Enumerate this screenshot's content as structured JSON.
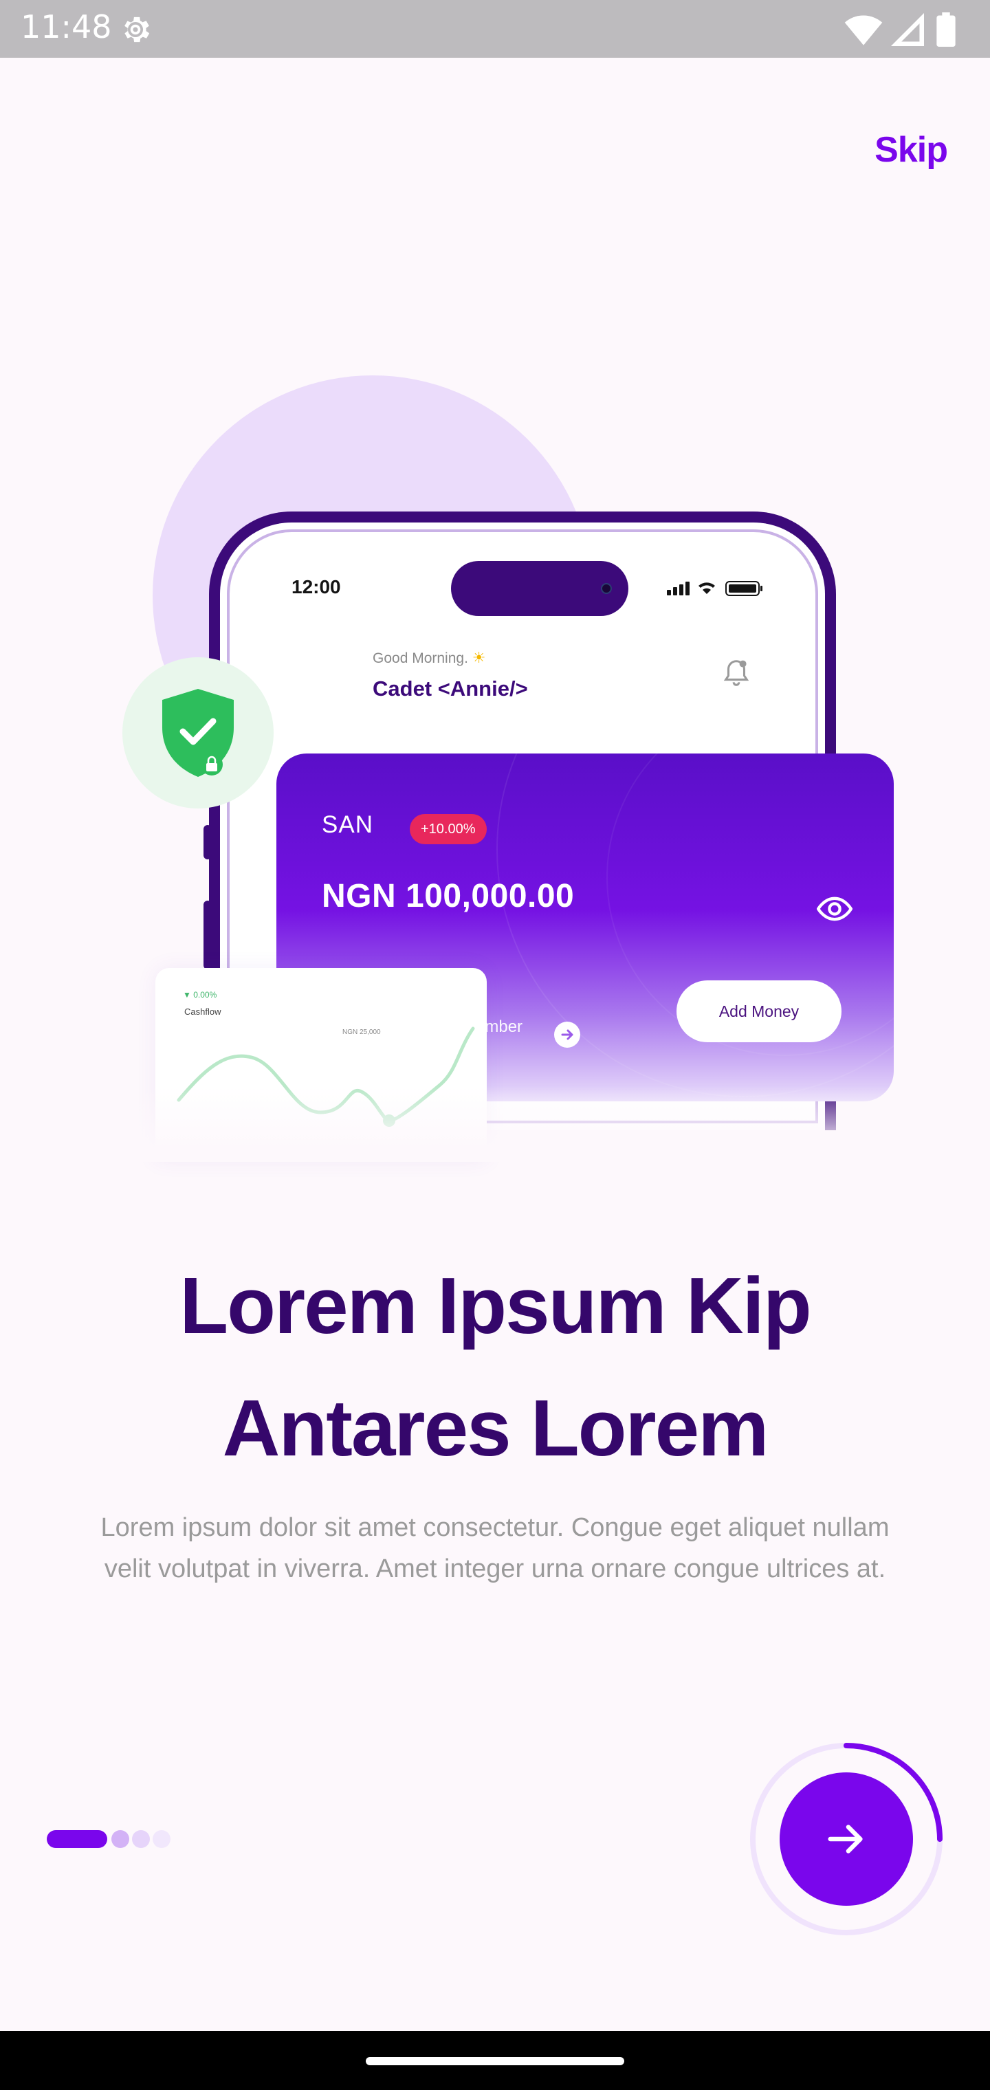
{
  "status_bar": {
    "time": "11:48",
    "icons": [
      "settings-gear-icon",
      "wifi-icon",
      "cellular-signal-icon",
      "battery-icon"
    ]
  },
  "header": {
    "skip_label": "Skip"
  },
  "illustration": {
    "phone": {
      "time": "12:00",
      "greeting": "Good Morning.",
      "user_name": "Cadet <Annie/>"
    },
    "wallet": {
      "code": "SAN",
      "change_badge": "+10.00%",
      "balance": "NGN 100,000.00",
      "account_label": "umber",
      "add_money_label": "Add Money"
    },
    "cashflow": {
      "change": "▼ 0.00%",
      "title": "Cashflow",
      "tooltip": "NGN 25,000"
    }
  },
  "content": {
    "headline_line1": "Lorem Ipsum Kip",
    "headline_line2": "Antares Lorem",
    "description": "Lorem ipsum dolor sit amet consectetur. Congue eget aliquet nullam velit volutpat in viverra. Amet integer urna ornare congue ultrices at."
  },
  "pager": {
    "total_pages": 4,
    "current_page": 1
  },
  "next_button": {
    "progress": 0.25
  },
  "colors": {
    "accent": "#7A06EC",
    "headline": "#35076B",
    "background": "#FDF8FC",
    "shield_green": "#2DBE5C",
    "badge_red": "#E8275C"
  }
}
